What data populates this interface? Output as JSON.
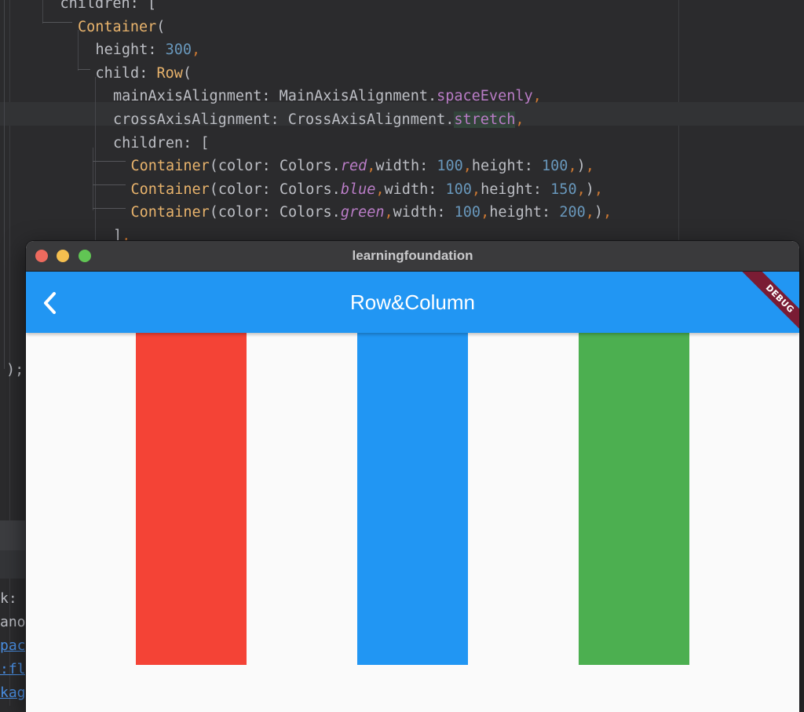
{
  "editor": {
    "code_lines": [
      {
        "indent": 3,
        "parts": [
          [
            "children: [",
            "plain"
          ]
        ]
      },
      {
        "indent": 4,
        "parts": [
          [
            "Container",
            "class"
          ],
          [
            "(",
            "plain"
          ]
        ]
      },
      {
        "indent": 5,
        "parts": [
          [
            "height: ",
            "plain"
          ],
          [
            "300",
            "num"
          ],
          [
            ",",
            "punc"
          ]
        ]
      },
      {
        "indent": 5,
        "parts": [
          [
            "child: ",
            "plain"
          ],
          [
            "Row",
            "class"
          ],
          [
            "(",
            "plain"
          ]
        ]
      },
      {
        "indent": 6,
        "parts": [
          [
            "mainAxisAlignment: MainAxisAlignment.",
            "plain"
          ],
          [
            "spaceEvenly",
            "prop"
          ],
          [
            ",",
            "punc"
          ]
        ]
      },
      {
        "indent": 6,
        "parts": [
          [
            "crossAxisAlignment: CrossAxisAlignment.",
            "plain"
          ],
          [
            "stretch",
            "prop-hl"
          ],
          [
            ",",
            "punc"
          ]
        ]
      },
      {
        "indent": 6,
        "parts": [
          [
            "children: [",
            "plain"
          ]
        ]
      },
      {
        "indent": 7,
        "parts": [
          [
            "Container",
            "class"
          ],
          [
            "(color: Colors.",
            "plain"
          ],
          [
            "red",
            "ital"
          ],
          [
            ",",
            "punc"
          ],
          [
            "width: ",
            "plain"
          ],
          [
            "100",
            "num"
          ],
          [
            ",",
            "punc"
          ],
          [
            "height: ",
            "plain"
          ],
          [
            "100",
            "num"
          ],
          [
            ",",
            "punc"
          ],
          [
            ")",
            "plain"
          ],
          [
            ",",
            "punc"
          ]
        ]
      },
      {
        "indent": 7,
        "parts": [
          [
            "Container",
            "class"
          ],
          [
            "(color: Colors.",
            "plain"
          ],
          [
            "blue",
            "ital"
          ],
          [
            ",",
            "punc"
          ],
          [
            "width: ",
            "plain"
          ],
          [
            "100",
            "num"
          ],
          [
            ",",
            "punc"
          ],
          [
            "height: ",
            "plain"
          ],
          [
            "150",
            "num"
          ],
          [
            ",",
            "punc"
          ],
          [
            ")",
            "plain"
          ],
          [
            ",",
            "punc"
          ]
        ]
      },
      {
        "indent": 7,
        "parts": [
          [
            "Container",
            "class"
          ],
          [
            "(color: Colors.",
            "plain"
          ],
          [
            "green",
            "ital"
          ],
          [
            ",",
            "punc"
          ],
          [
            "width: ",
            "plain"
          ],
          [
            "100",
            "num"
          ],
          [
            ",",
            "punc"
          ],
          [
            "height: ",
            "plain"
          ],
          [
            "200",
            "num"
          ],
          [
            ",",
            "punc"
          ],
          [
            ")",
            "plain"
          ],
          [
            ",",
            "punc"
          ]
        ]
      },
      {
        "indent": 6,
        "parts": [
          [
            "]",
            "plain"
          ],
          [
            ",",
            "punc"
          ]
        ]
      }
    ],
    "closing_text": ");",
    "left_fragments": [
      "k:",
      "ano",
      "pac",
      ":fl",
      "kag"
    ]
  },
  "window": {
    "title": "learningfoundation",
    "traffic_lights": {
      "close": "#ed6a5e",
      "minimize": "#f5bf4f",
      "zoom": "#61c554"
    }
  },
  "appbar": {
    "title": "Row&Column",
    "back_icon": "chevron-left-icon",
    "color": "#2196f3",
    "debug_banner": "DEBUG"
  },
  "row": {
    "main_axis_alignment": "spaceEvenly",
    "cross_axis_alignment": "stretch",
    "children": [
      {
        "name": "red-container",
        "color": "#f44336"
      },
      {
        "name": "blue-container",
        "color": "#2196f3"
      },
      {
        "name": "green-container",
        "color": "#4caf50"
      }
    ]
  }
}
